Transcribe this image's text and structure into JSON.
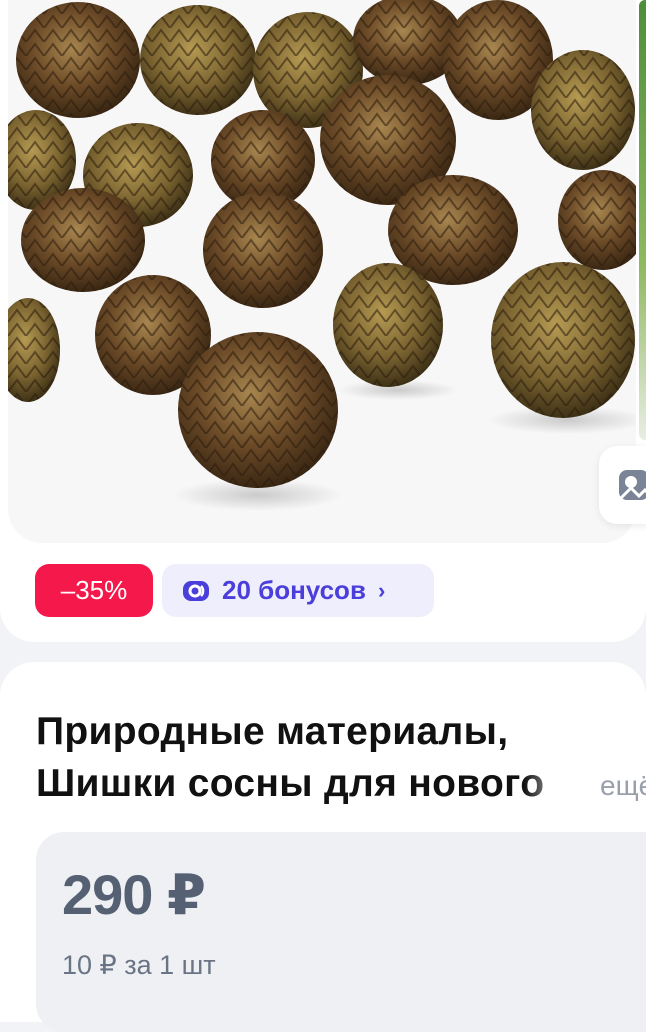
{
  "product": {
    "image_alt": "Шишки сосны",
    "discount_badge": "–35%",
    "bonus": {
      "label": "20 бонусов",
      "chevron": "›"
    },
    "title_line1": "Природные материалы,",
    "title_line2": "Шишки сосны для нового",
    "more_link": "ещё",
    "price": "290 ₽",
    "unit_price": "10 ₽ за 1 шт"
  },
  "colors": {
    "discount_bg": "#f5194b",
    "bonus_bg": "#efeefc",
    "bonus_text": "#4b3fdb",
    "price_text": "#556073"
  },
  "icons": [
    "coin-icon",
    "chevron-right-icon",
    "similar-search-icon"
  ]
}
